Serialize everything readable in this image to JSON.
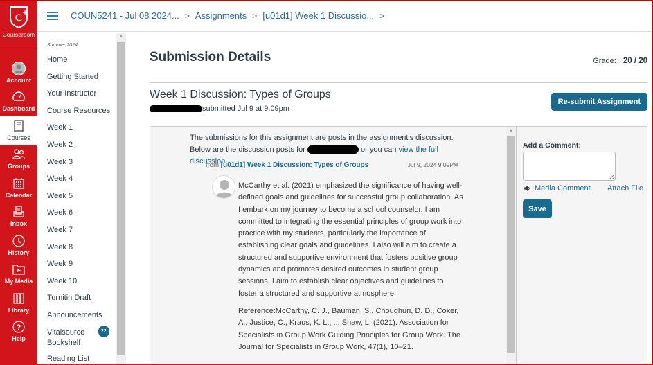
{
  "global_nav": {
    "logo_label": "Courseroom",
    "items": [
      {
        "label": "Account",
        "icon": "account-icon",
        "active": false
      },
      {
        "label": "Dashboard",
        "icon": "dashboard-icon",
        "active": false
      },
      {
        "label": "Courses",
        "icon": "courses-icon",
        "active": true
      },
      {
        "label": "Groups",
        "icon": "groups-icon",
        "active": false
      },
      {
        "label": "Calendar",
        "icon": "calendar-icon",
        "active": false
      },
      {
        "label": "Inbox",
        "icon": "inbox-icon",
        "active": false
      },
      {
        "label": "History",
        "icon": "history-icon",
        "active": false
      },
      {
        "label": "My Media",
        "icon": "media-icon",
        "active": false
      },
      {
        "label": "Library",
        "icon": "library-icon",
        "active": false
      },
      {
        "label": "Help",
        "icon": "help-icon",
        "active": false
      }
    ],
    "brand_color": "#d2151b"
  },
  "breadcrumb": [
    "COUN5241 - Jul 08 2024...",
    "Assignments",
    "[u01d1] Week 1 Discussio..."
  ],
  "course_nav": {
    "term": "Summer 2024",
    "items": [
      "Home",
      "Getting Started",
      "Your Instructor",
      "Course Resources",
      "Week 1",
      "Week 2",
      "Week 3",
      "Week 4",
      "Week 5",
      "Week 6",
      "Week 7",
      "Week 8",
      "Week 9",
      "Week 10",
      "Turnitin Draft",
      "Announcements",
      "Vitalsource Bookshelf",
      "Reading List"
    ],
    "badge_item": "Announcements",
    "badge_count": "22"
  },
  "main": {
    "title": "Submission Details",
    "grade_label": "Grade:",
    "grade_value": "20 / 20",
    "assignment_title": "Week 1 Discussion: Types of Groups",
    "submitted_text": "submitted Jul 9 at 9:09pm",
    "resubmit_label": "Re-submit Assignment"
  },
  "discussion": {
    "intro_1": "The submissions for this assignment are posts in the assignment's discussion. Below are the discussion posts for",
    "intro_2": "or you can",
    "view_link": "view the full discussion",
    "intro_end": ".",
    "from_label": "from",
    "from_link": "[u01d1] Week 1 Discussion: Types of Groups",
    "post_date": "Jul 9, 2024 9:09PM",
    "post_p1": "McCarthy et al. (2021) emphasized the significance of having well-defined goals and guidelines for successful group collaboration. As I embark on my journey to become a school counselor, I am committed to integrating the essential principles of group work into practice with my students, particularly the importance of establishing clear goals and guidelines. I also will aim to create a structured and supportive environment that fosters positive group dynamics and promotes desired outcomes in student group sessions. I aim to establish clear objectives and guidelines to foster a structured and supportive atmosphere.",
    "post_p2": "Reference:McCarthy, C. J., Bauman, S., Choudhuri, D. D., Coker, A., Justice, C., Kraus, K. L., ... Shaw, L. (2021). Association for Specialists in Group Work Guiding Principles for Group Work. The Journal for Specialists in Group Work, 47(1), 10–21."
  },
  "comments": {
    "label": "Add a Comment:",
    "value": "",
    "media_comment": "Media Comment",
    "attach_file": "Attach File",
    "save_label": "Save"
  }
}
